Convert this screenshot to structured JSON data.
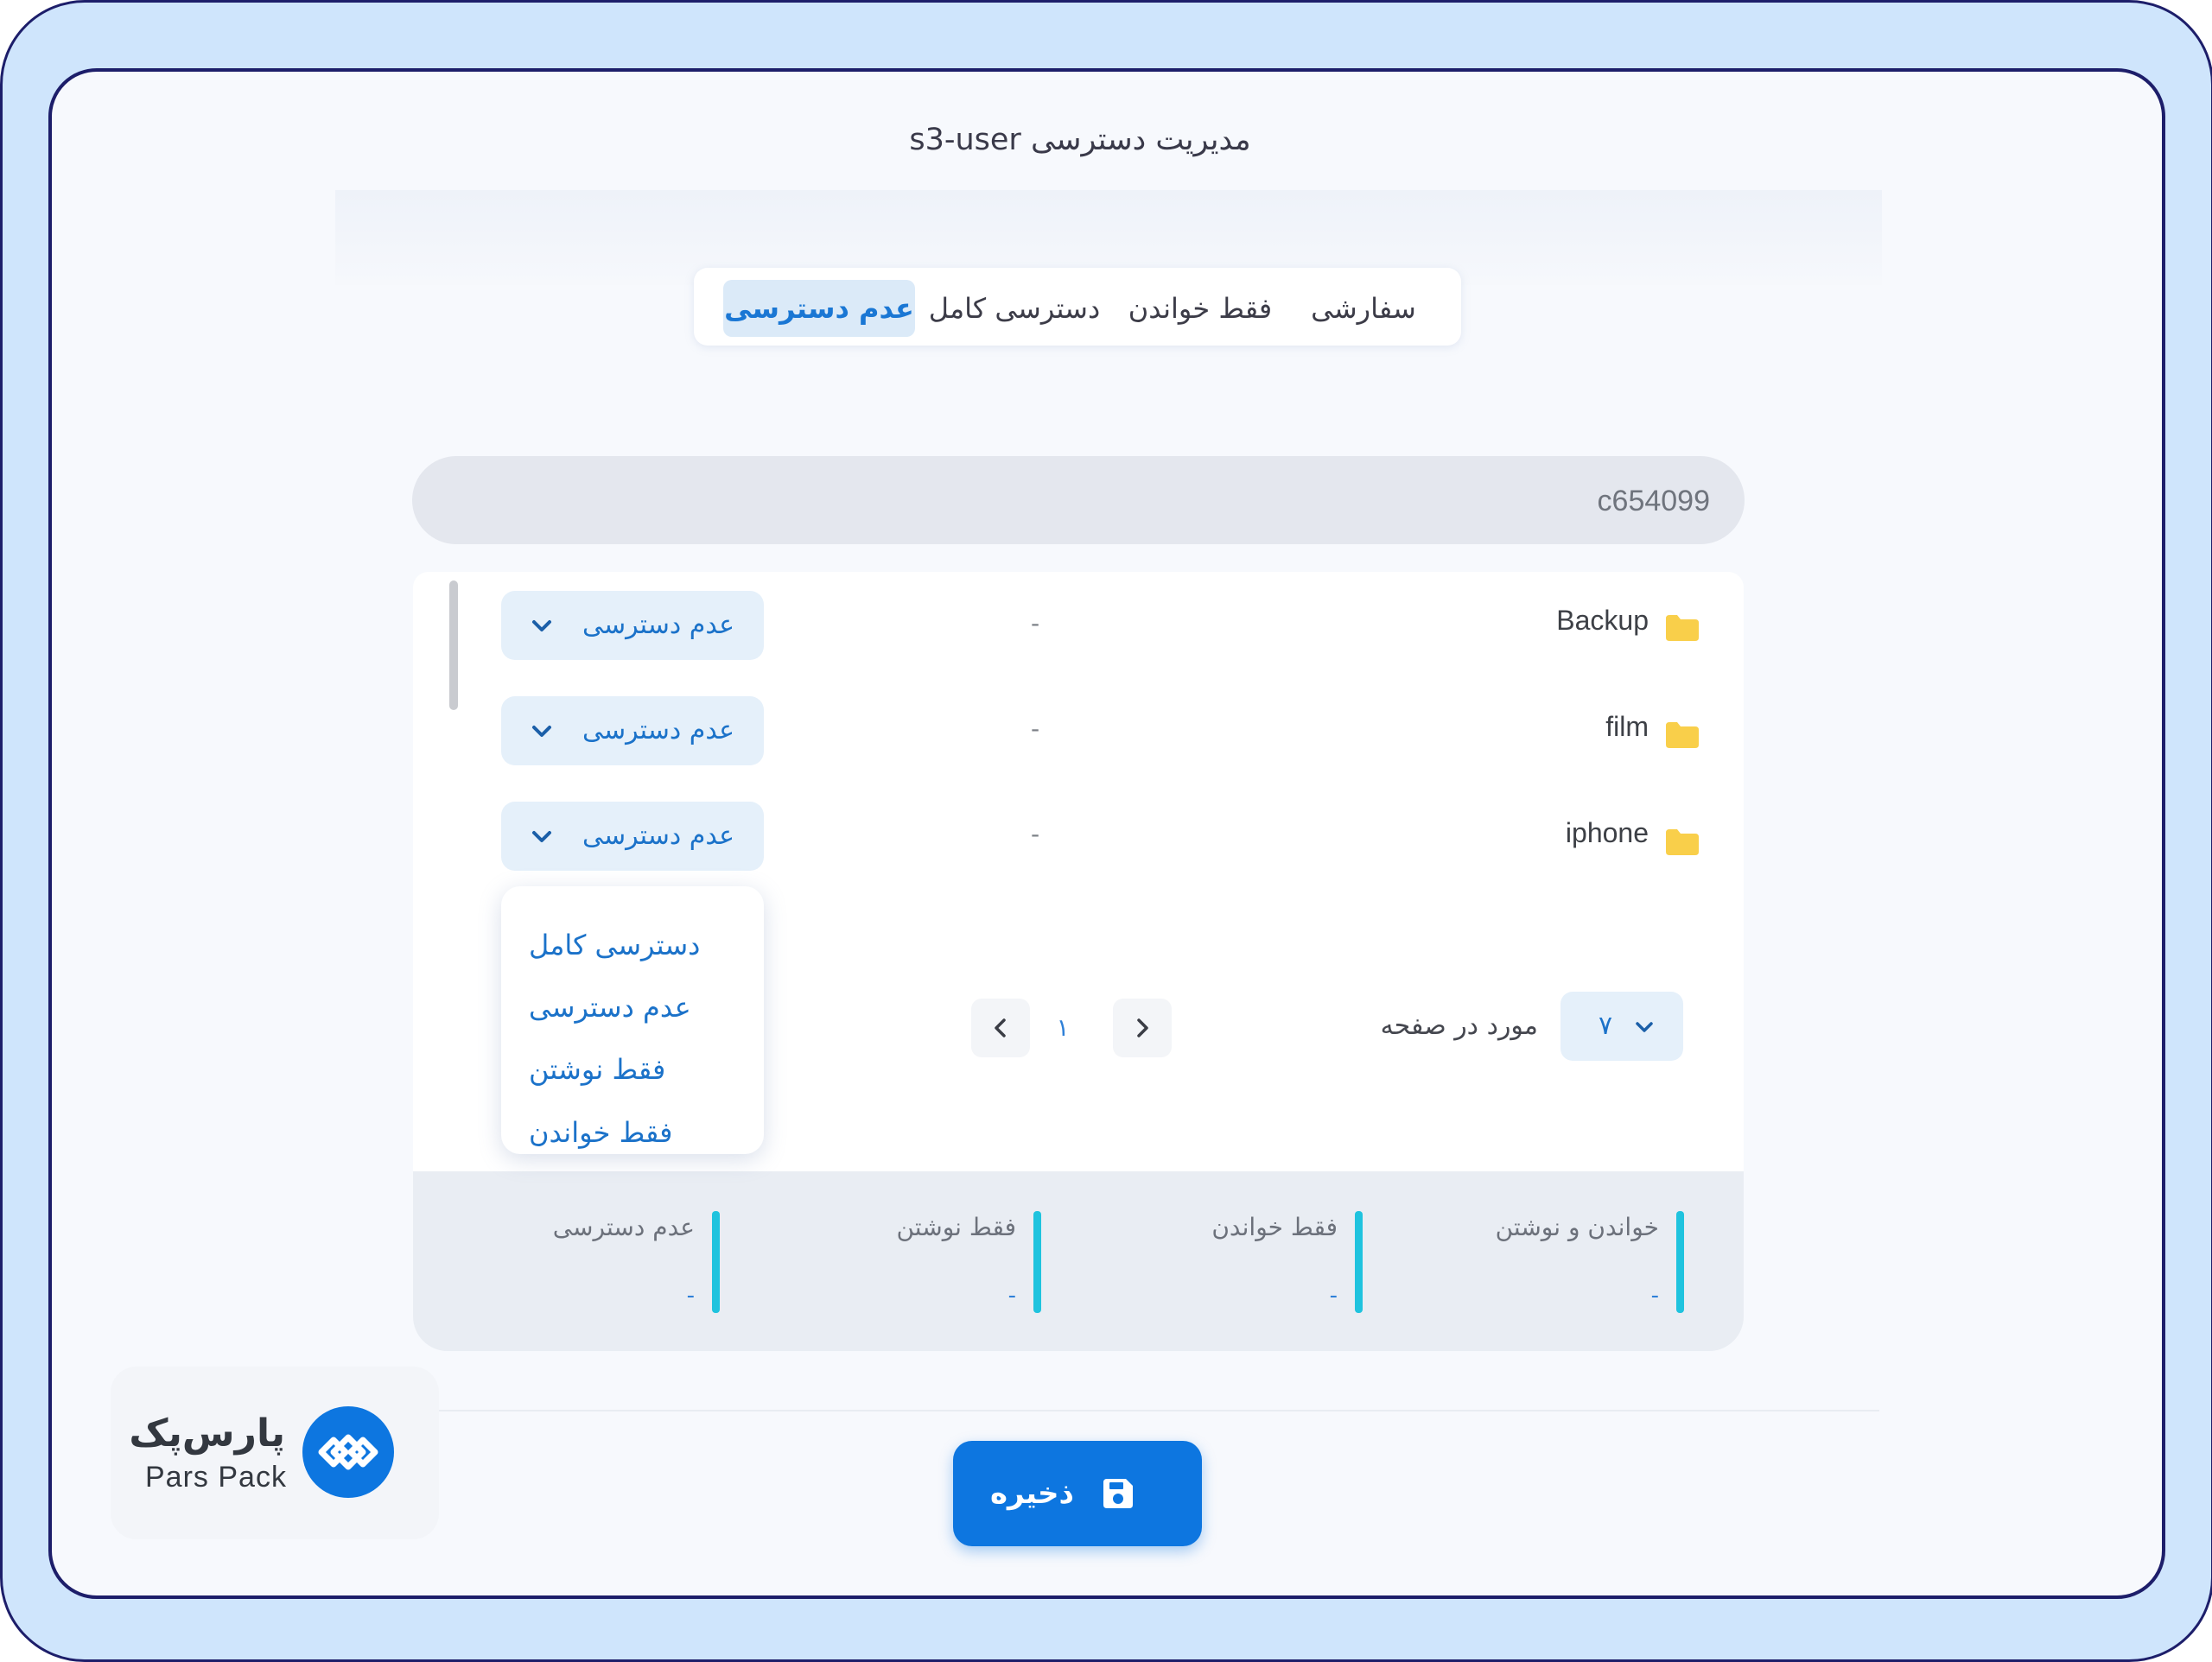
{
  "page": {
    "title": "مدیریت دسترسی s3-user"
  },
  "tabs": [
    {
      "label": "عدم دسترسی",
      "active": true
    },
    {
      "label": "دسترسی کامل",
      "active": false
    },
    {
      "label": "فقط خواندن",
      "active": false
    },
    {
      "label": "سفارشی",
      "active": false
    }
  ],
  "search": {
    "value": "c654099"
  },
  "folders": [
    {
      "name": "Backup",
      "detail": "-",
      "permission": "عدم دسترسی"
    },
    {
      "name": "film",
      "detail": "-",
      "permission": "عدم دسترسی"
    },
    {
      "name": "iphone",
      "detail": "-",
      "permission": "عدم دسترسی"
    }
  ],
  "dropdown": {
    "open": true,
    "options": [
      "دسترسی کامل",
      "عدم دسترسی",
      "فقط نوشتن",
      "فقط خواندن"
    ]
  },
  "pagination": {
    "current_page": "۱",
    "per_page_label": "مورد در صفحه",
    "per_page_value": "۷"
  },
  "stats": [
    {
      "label": "خواندن و نوشتن",
      "value": "-"
    },
    {
      "label": "فقط خواندن",
      "value": "-"
    },
    {
      "label": "فقط نوشتن",
      "value": "-"
    },
    {
      "label": "عدم دسترسی",
      "value": "-"
    }
  ],
  "actions": {
    "save_label": "ذخیره"
  },
  "brand": {
    "logo_fa": "پارس‌پک",
    "logo_en": "Pars Pack"
  },
  "colors": {
    "frame_outer": "#cfe5fc",
    "frame_border": "#1d1e6a",
    "accent_blue": "#0d76e0",
    "link_blue": "#1b72c9",
    "stat_accent": "#1fc3de",
    "folder_yellow": "#f9cf4a"
  },
  "icons": {
    "folder": "folder-icon",
    "chevron": "chevron-down-icon",
    "prev": "chevron-left-icon",
    "next": "chevron-right-icon",
    "save": "save-icon",
    "logo": "parspack-logo-icon"
  }
}
